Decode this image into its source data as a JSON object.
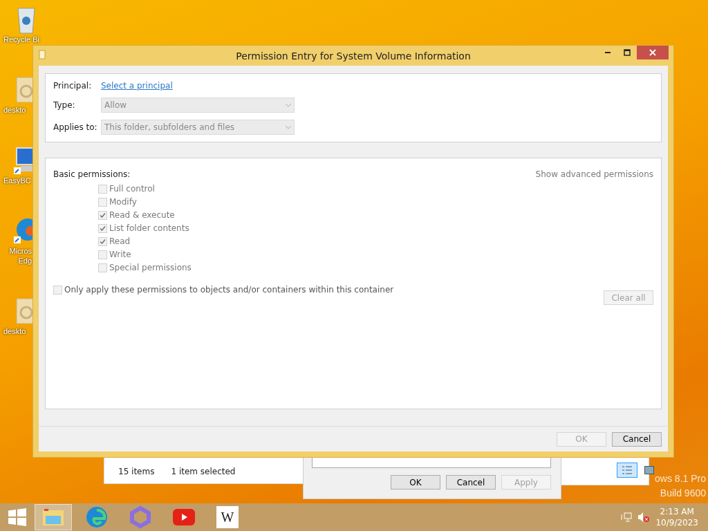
{
  "desktop_icons": [
    {
      "kind": "bin",
      "label": "Recycle Bi"
    },
    {
      "kind": "gear",
      "label": "deskto"
    },
    {
      "kind": "monitor",
      "label": "EasyBC"
    },
    {
      "kind": "browser",
      "label": "Micros Edg"
    },
    {
      "kind": "gear",
      "label": "deskto"
    }
  ],
  "os_build_text": [
    "ows 8.1 Pro",
    "Build 9600"
  ],
  "explorer_window": {
    "item_count": "15 items",
    "selection": "1 item selected",
    "views": [
      {
        "kind": "details",
        "selected": true
      },
      {
        "kind": "preview",
        "selected": false
      }
    ]
  },
  "properties_dialog": {
    "buttons": [
      {
        "label": "OK",
        "disabled": false
      },
      {
        "label": "Cancel",
        "disabled": false
      },
      {
        "label": "Apply",
        "disabled": true
      }
    ]
  },
  "dialog": {
    "title": "Permission Entry for System Volume Information",
    "principal_label": "Principal:",
    "principal_link": "Select a principal",
    "type_label": "Type:",
    "type_value": "Allow",
    "applies_label": "Applies to:",
    "applies_value": "This folder, subfolders and files",
    "section_label": "Basic permissions:",
    "advanced_link": "Show advanced permissions",
    "permissions": [
      {
        "label": "Full control",
        "checked": false
      },
      {
        "label": "Modify",
        "checked": false
      },
      {
        "label": "Read & execute",
        "checked": true
      },
      {
        "label": "List folder contents",
        "checked": true
      },
      {
        "label": "Read",
        "checked": true
      },
      {
        "label": "Write",
        "checked": false
      },
      {
        "label": "Special permissions",
        "checked": false
      }
    ],
    "only_apply": {
      "label": "Only apply these permissions to objects and/or containers within this container",
      "checked": false
    },
    "clear_all": "Clear all",
    "buttons": [
      {
        "label": "OK",
        "disabled": true
      },
      {
        "label": "Cancel",
        "disabled": false
      }
    ]
  },
  "taskbar": {
    "apps": [
      {
        "kind": "explorer",
        "selected": true
      },
      {
        "kind": "edge",
        "selected": false
      },
      {
        "kind": "copilot",
        "selected": false
      },
      {
        "kind": "youtube",
        "selected": false
      },
      {
        "kind": "wiki",
        "label": "W",
        "selected": false
      }
    ],
    "time": "2:13 AM",
    "date": "10/9/2023"
  }
}
